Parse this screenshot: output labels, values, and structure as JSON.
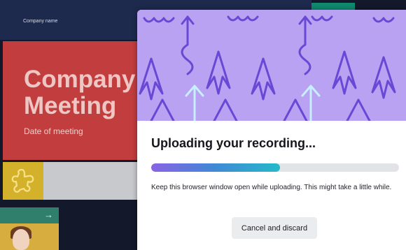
{
  "slide": {
    "company_small": "Company name",
    "title_line1": "Company",
    "title_line2": "Meeting",
    "date": "Date of meeting"
  },
  "colors": {
    "slide_header": "#1d2a4d",
    "slide_red": "#c23d3e",
    "hero_purple": "#b9a2f2",
    "hero_pattern": "#6a48d6",
    "hero_accent": "#c8efff",
    "progress_start": "#8a62e3",
    "progress_end": "#26b9c8"
  },
  "thumbnail": {
    "icon": "arrow-right-icon"
  },
  "dialog": {
    "title": "Uploading your recording...",
    "progress": 0.52,
    "message": "Keep this browser window open while uploading. This might take a little while.",
    "cancel_label": "Cancel and discard"
  }
}
